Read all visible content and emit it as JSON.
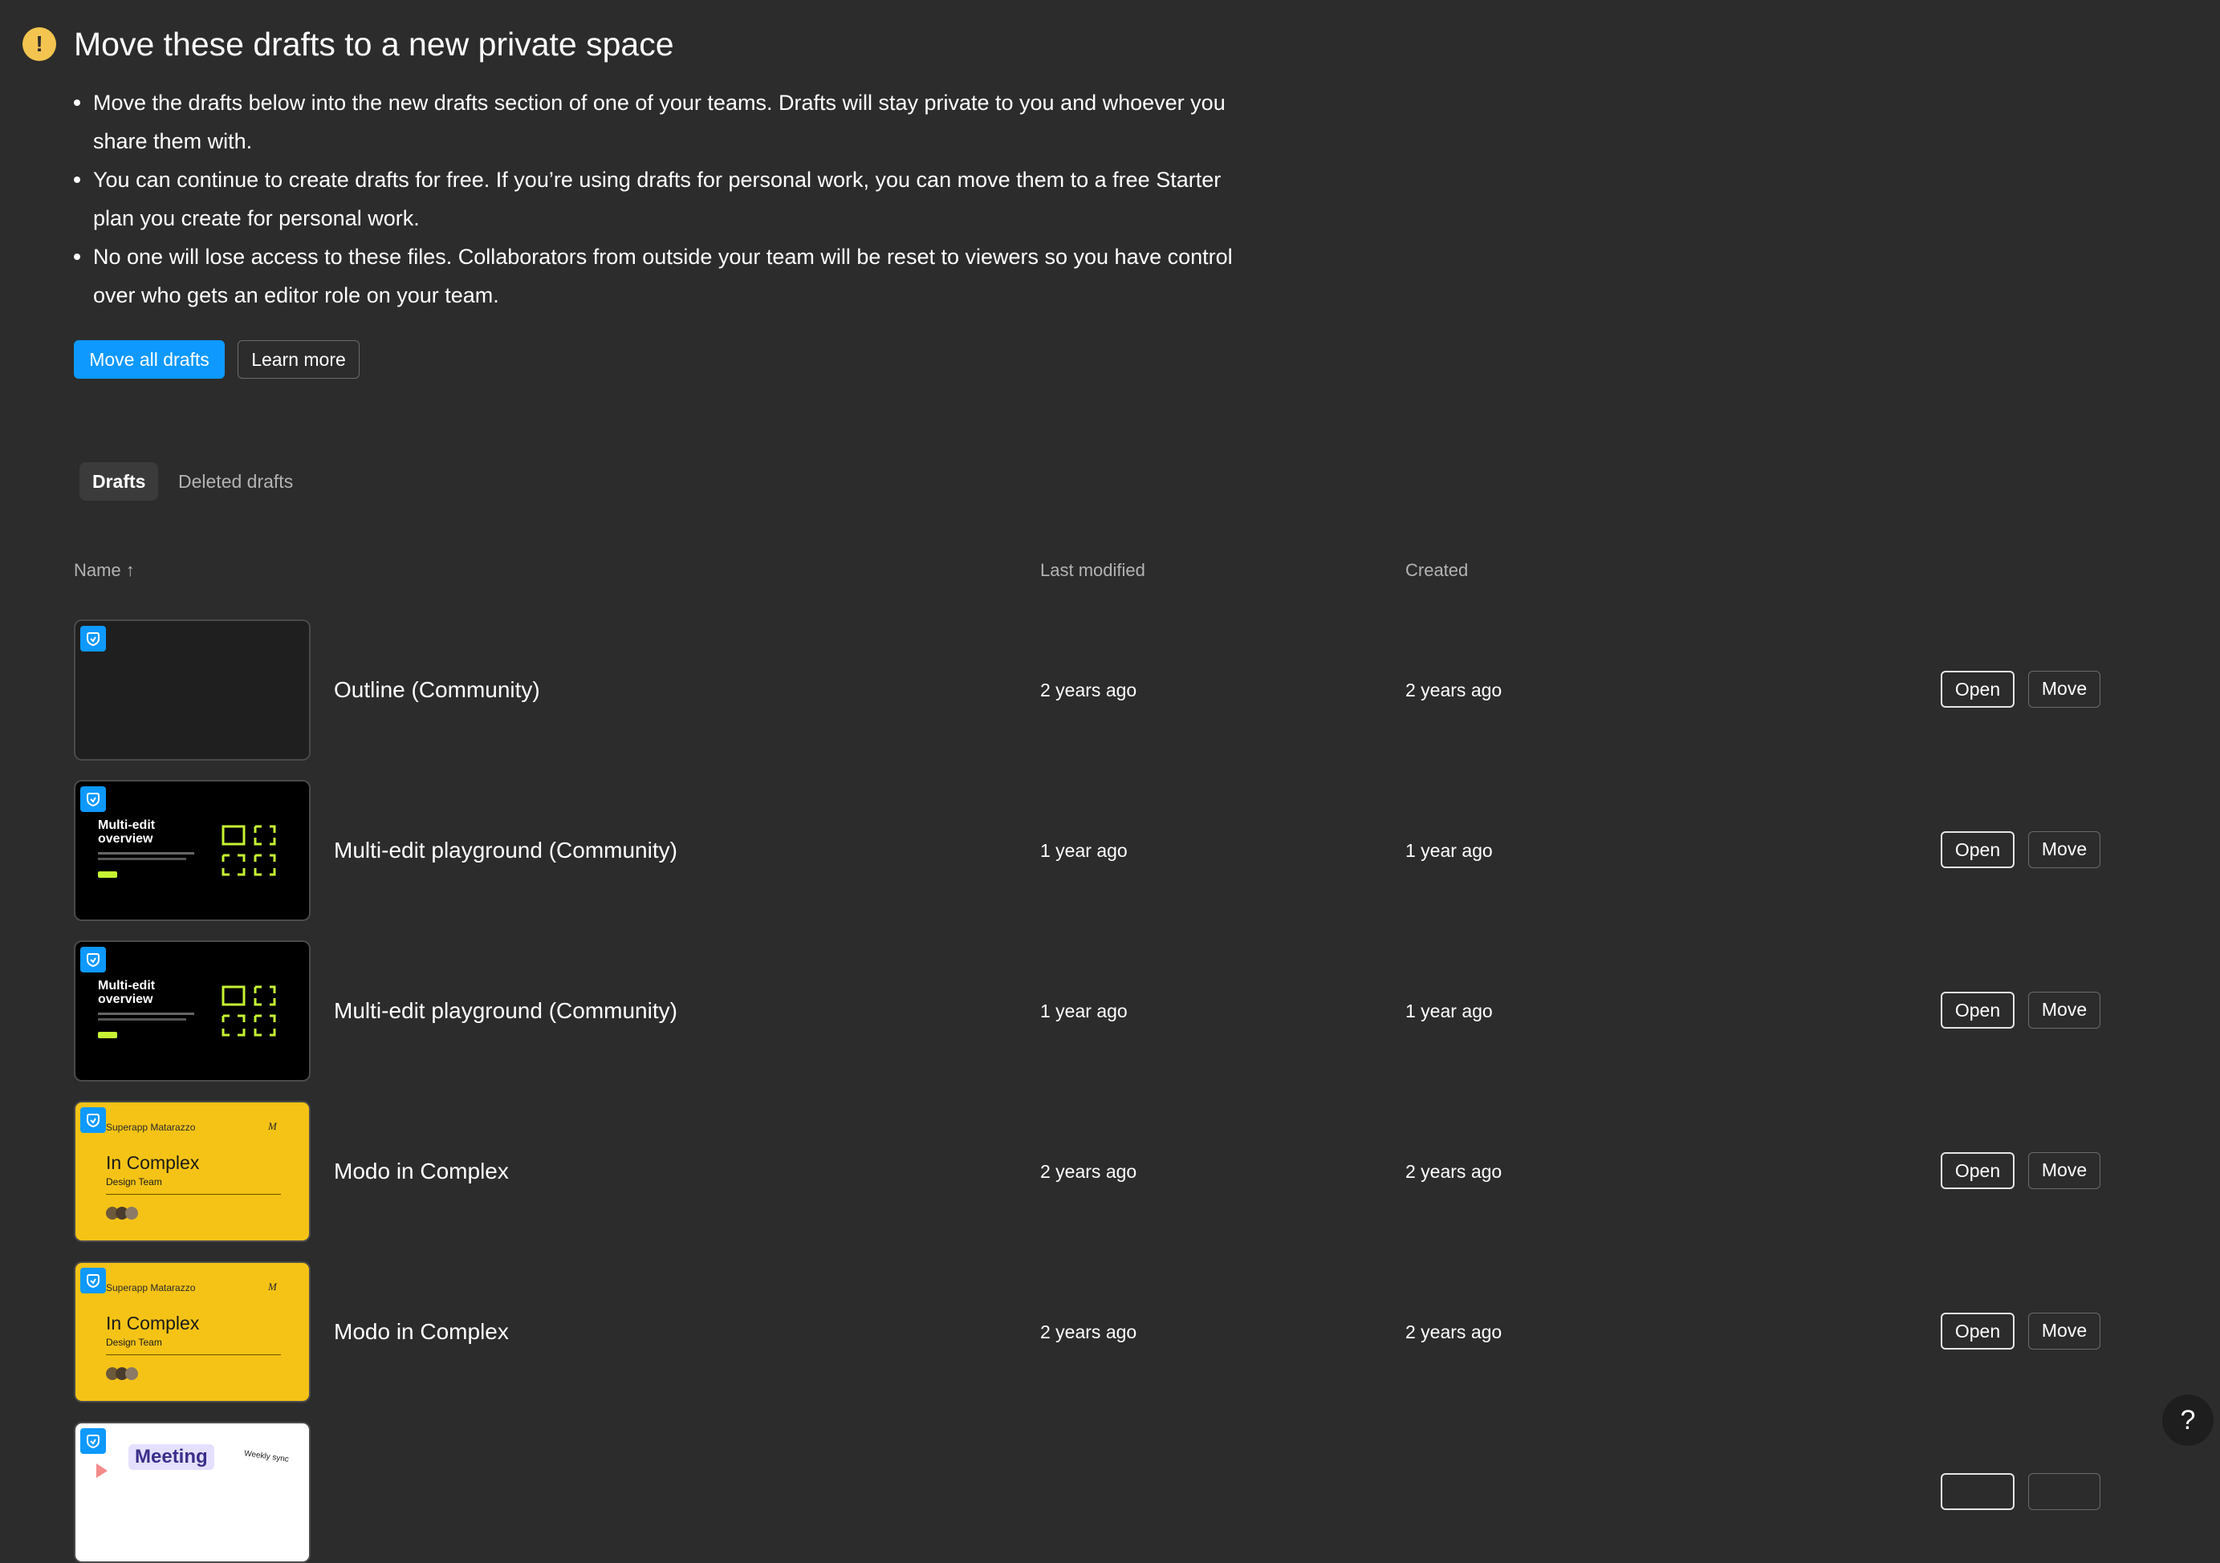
{
  "banner": {
    "title": "Move these drafts to a new private space",
    "bullets": [
      "Move the drafts below into the new drafts section of one of your teams. Drafts will stay private to you and whoever you share them with.",
      "You can continue to create drafts for free. If you’re using drafts for personal work, you can move them to a free Starter plan you create for personal work.",
      "No one will lose access to these files. Collaborators from outside your team will be reset to viewers so you have control over who gets an editor role on your team."
    ],
    "primary_button": "Move all drafts",
    "secondary_button": "Learn more",
    "icon": "warning-icon",
    "icon_color": "#f3c44f"
  },
  "tabs": [
    {
      "label": "Drafts",
      "active": true
    },
    {
      "label": "Deleted drafts",
      "active": false
    }
  ],
  "table": {
    "columns": {
      "name": "Name ↑",
      "modified": "Last modified",
      "created": "Created"
    },
    "rows": [
      {
        "name": "Outline (Community)",
        "modified": "2 years ago",
        "created": "2 years ago",
        "open": "Open",
        "move": "Move",
        "thumb": "dark"
      },
      {
        "name": "Multi-edit playground (Community)",
        "modified": "1 year ago",
        "created": "1 year ago",
        "open": "Open",
        "move": "Move",
        "thumb": "multiedit"
      },
      {
        "name": "Multi-edit playground (Community)",
        "modified": "1 year ago",
        "created": "1 year ago",
        "open": "Open",
        "move": "Move",
        "thumb": "multiedit"
      },
      {
        "name": "Modo in Complex",
        "modified": "2 years ago",
        "created": "2 years ago",
        "open": "Open",
        "move": "Move",
        "thumb": "modo"
      },
      {
        "name": "Modo in Complex",
        "modified": "2 years ago",
        "created": "2 years ago",
        "open": "Open",
        "move": "Move",
        "thumb": "modo"
      },
      {
        "name": "",
        "modified": "",
        "created": "",
        "open": "",
        "move": "",
        "thumb": "meeting"
      }
    ]
  },
  "thumb_text": {
    "multiedit_title": "Multi-edit overview",
    "modo_brand": "Superapp Matarazzo",
    "modo_title": "In Complex",
    "modo_sub": "Design Team",
    "meeting_title": "Meeting",
    "meeting_side": "Weekly sync"
  },
  "help": "?",
  "colors": {
    "accent": "#0d99ff",
    "background": "#2c2c2c",
    "modo_yellow": "#f5c316",
    "multiedit_green": "#c6f432"
  }
}
